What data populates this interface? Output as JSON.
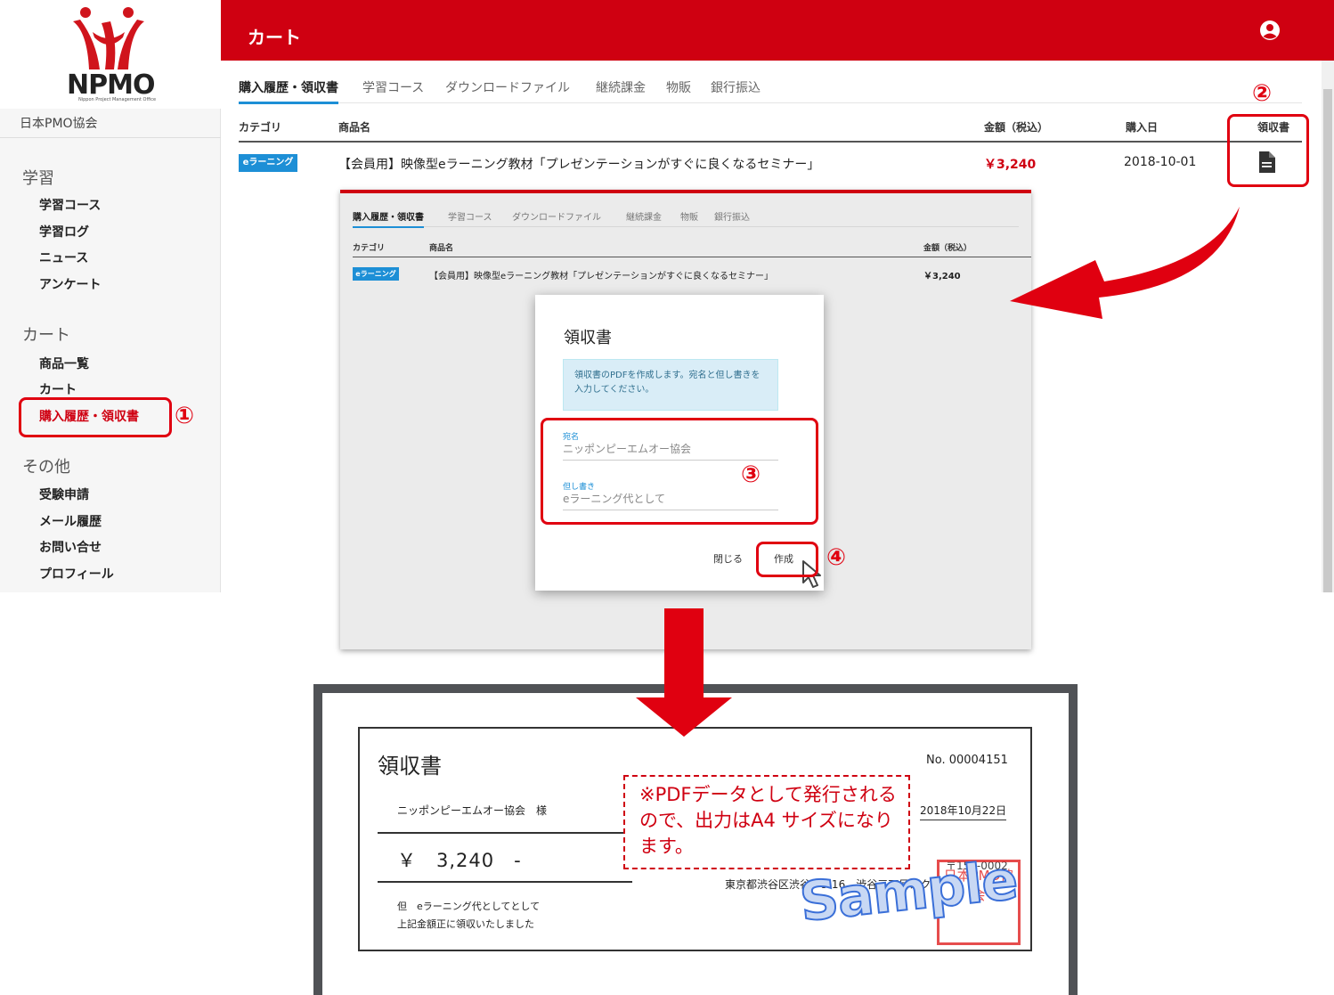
{
  "app": {
    "logo_text": "NPMO",
    "logo_subtext": "Nippon Project Management Office",
    "org_name": "日本PMO協会"
  },
  "sidebar": {
    "sections": [
      {
        "heading": "学習",
        "items": [
          "学習コース",
          "学習ログ",
          "ニュース",
          "アンケート"
        ]
      },
      {
        "heading": "カート",
        "items": [
          "商品一覧",
          "カート",
          "購入履歴・領収書"
        ]
      },
      {
        "heading": "その他",
        "items": [
          "受験申請",
          "メール履歴",
          "お問い合せ",
          "プロフィール"
        ]
      }
    ]
  },
  "header": {
    "title": "カート",
    "account_icon": "account-circle-icon"
  },
  "tabs": [
    "購入履歴・領収書",
    "学習コース",
    "ダウンロードファイル",
    "継続課金",
    "物販",
    "銀行振込"
  ],
  "table": {
    "columns": [
      "カテゴリ",
      "商品名",
      "金額（税込）",
      "購入日",
      "領収書"
    ],
    "rows": [
      {
        "category": "eラーニング",
        "product": "【会員用】映像型eラーニング教材「プレゼンテーションがすぐに良くなるセミナー」",
        "price": "￥3,240",
        "date": "2018-10-01",
        "receipt_icon": "document-icon"
      }
    ]
  },
  "inner_screenshot": {
    "tabs": [
      "購入履歴・領収書",
      "学習コース",
      "ダウンロードファイル",
      "継続課金",
      "物販",
      "銀行振込"
    ],
    "columns": [
      "カテゴリ",
      "商品名",
      "金額（税込）"
    ],
    "row": {
      "category": "eラーニング",
      "product": "【会員用】映像型eラーニング教材「プレゼンテーションがすぐに良くなるセミナー」",
      "price": "￥3,240"
    }
  },
  "modal": {
    "title": "領収書",
    "info": "領収書のPDFを作成します。宛名と但し書きを入力してください。",
    "address_label": "宛名",
    "address_value": "ニッポンピーエムオー協会",
    "proviso_label": "但し書き",
    "proviso_value": "eラーニング代として",
    "close_button": "閉じる",
    "create_button": "作成"
  },
  "receipt": {
    "title": "領収書",
    "number": "No. 00004151",
    "addressee": "ニッポンピーエムオー協会　様",
    "date": "2018年10月22日",
    "amount": "￥　3,240　-",
    "proviso": "但　eラーニング代としてとして",
    "acknowledgement": "上記金額正に領収いたしました",
    "issuer_address": "東京都渋谷区渋谷3-5-16　渋谷三丁目スク",
    "postal": "〒150-0002",
    "seal_text": "日本PMO協会",
    "watermark": "Sample"
  },
  "note": "※PDFデータとして発行されるので、出力はA4 サイズになります。",
  "annotations": [
    "①",
    "②",
    "③",
    "④"
  ],
  "colors": {
    "brand_red": "#cf0011",
    "accent_blue": "#1d8fd6"
  }
}
